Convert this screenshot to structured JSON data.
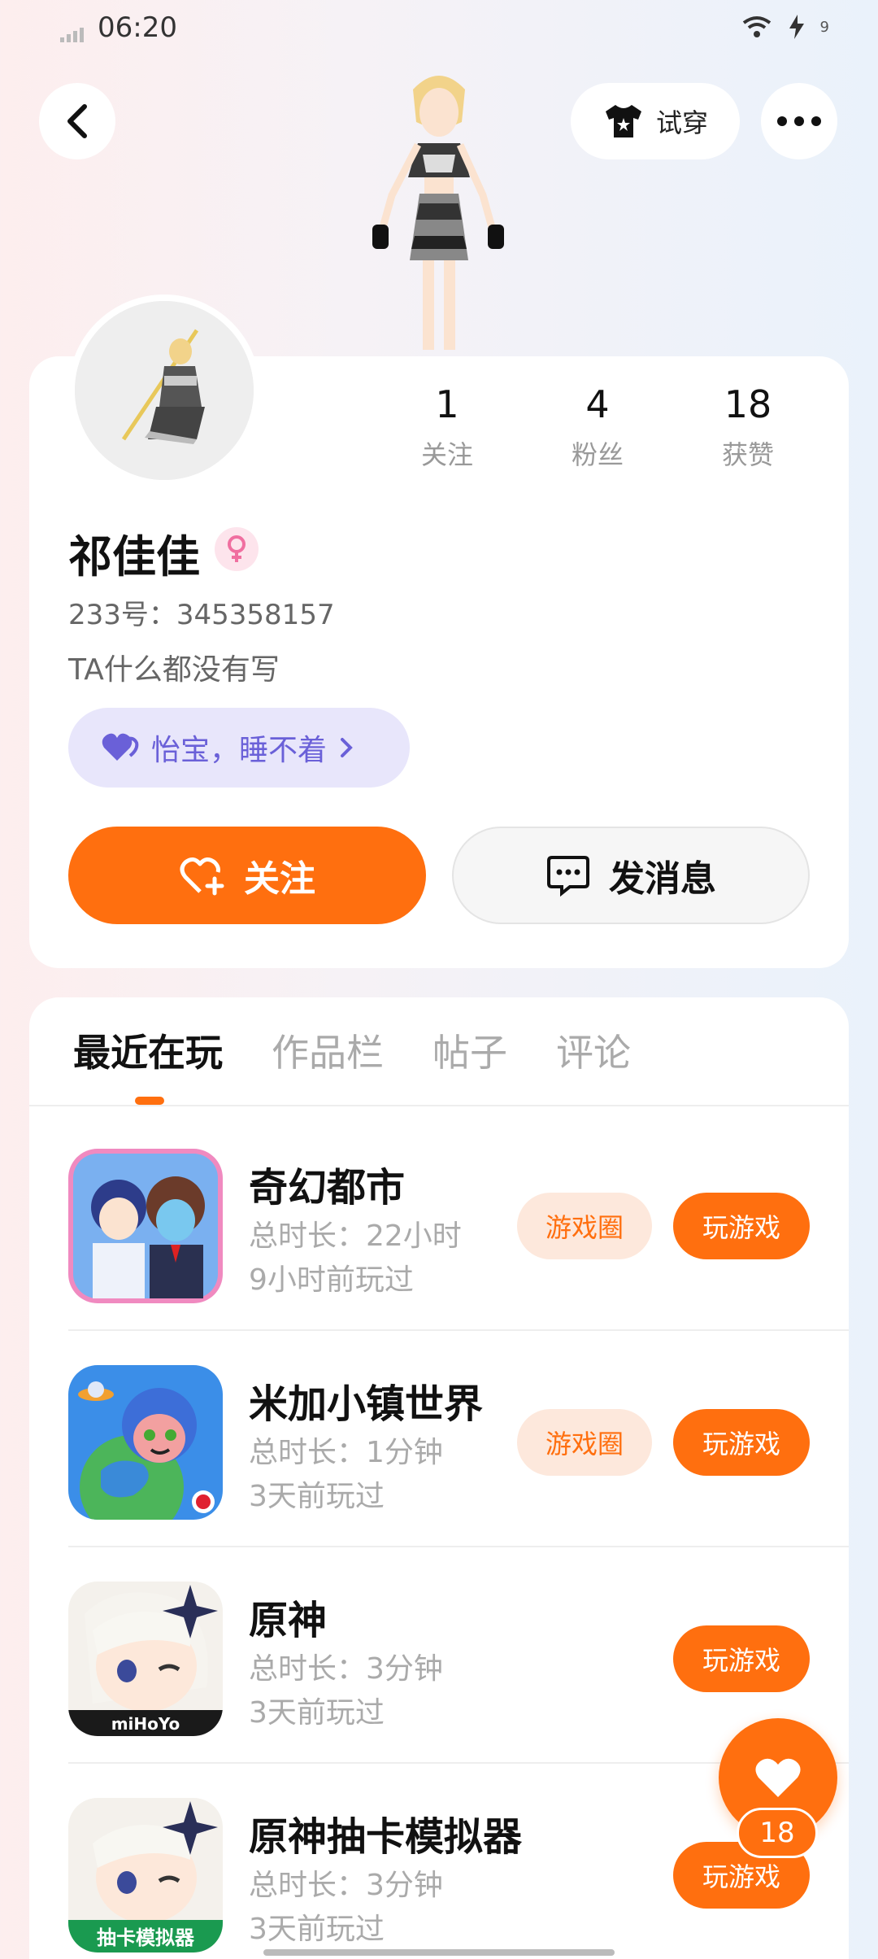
{
  "status_bar": {
    "time": "06:20",
    "battery_label": "9"
  },
  "top_bar": {
    "try_on_label": "试穿"
  },
  "profile": {
    "username": "祁佳佳",
    "uid": "233号：345358157",
    "bio": "TA什么都没有写",
    "status_text": "怡宝，睡不着",
    "stats": [
      {
        "value": "1",
        "label": "关注"
      },
      {
        "value": "4",
        "label": "粉丝"
      },
      {
        "value": "18",
        "label": "获赞"
      }
    ],
    "follow_label": "关注",
    "message_label": "发消息"
  },
  "tabs": [
    {
      "label": "最近在玩"
    },
    {
      "label": "作品栏"
    },
    {
      "label": "帖子"
    },
    {
      "label": "评论"
    }
  ],
  "games": [
    {
      "title": "奇幻都市",
      "duration": "总时长：22小时",
      "last_played": "9小时前玩过",
      "circle_label": "游戏圈",
      "play_label": "玩游戏"
    },
    {
      "title": "米加小镇世界",
      "duration": "总时长：1分钟",
      "last_played": "3天前玩过",
      "circle_label": "游戏圈",
      "play_label": "玩游戏"
    },
    {
      "title": "原神",
      "duration": "总时长：3分钟",
      "last_played": "3天前玩过",
      "play_label": "玩游戏",
      "icon_brand": "miHoYo"
    },
    {
      "title": "原神抽卡模拟器",
      "duration": "总时长：3分钟",
      "last_played": "3天前玩过",
      "play_label": "玩游戏",
      "icon_caption": "抽卡模拟器"
    }
  ],
  "like_count": "18",
  "colors": {
    "accent": "#ff6f0f",
    "accent_light": "#fde8dc",
    "status_purple": "#6a60d8"
  }
}
